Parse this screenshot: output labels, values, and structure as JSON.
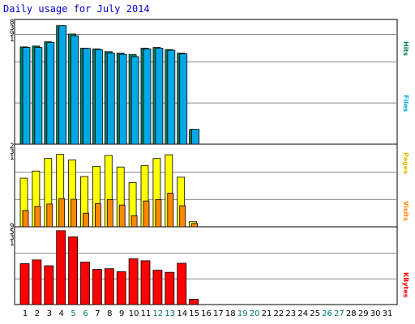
{
  "title": "Daily usage for July 2014",
  "chart_data": [
    {
      "type": "bar",
      "panel": "hits-files",
      "y_max_label": "8391",
      "categories": [
        "1",
        "2",
        "3",
        "4",
        "5",
        "6",
        "7",
        "8",
        "9",
        "10",
        "11",
        "12",
        "13",
        "14",
        "15",
        "16",
        "17",
        "18",
        "19",
        "20",
        "21",
        "22",
        "23",
        "24",
        "25",
        "26",
        "27",
        "28",
        "29",
        "30",
        "31"
      ],
      "weekend_days": [
        "5",
        "6",
        "12",
        "13",
        "19",
        "20",
        "26",
        "27"
      ],
      "series": [
        {
          "name": "Hits",
          "color": "#00805c",
          "values": [
            6890,
            6950,
            7250,
            8391,
            7800,
            6800,
            6750,
            6550,
            6450,
            6350,
            6800,
            6850,
            6700,
            6450,
            1050,
            0,
            0,
            0,
            0,
            0,
            0,
            0,
            0,
            0,
            0,
            0,
            0,
            0,
            0,
            0,
            0
          ]
        },
        {
          "name": "Files",
          "color": "#00a8e8",
          "values": [
            6850,
            6850,
            7200,
            8391,
            7680,
            6780,
            6700,
            6450,
            6350,
            6200,
            6750,
            6800,
            6650,
            6400,
            1050,
            0,
            0,
            0,
            0,
            0,
            0,
            0,
            0,
            0,
            0,
            0,
            0,
            0,
            0,
            0,
            0
          ]
        }
      ],
      "ylim": [
        0,
        8391
      ]
    },
    {
      "type": "bar",
      "panel": "pages-visits",
      "y_max_label": "231",
      "series": [
        {
          "name": "Pages",
          "color": "#ffff00",
          "values": [
            143,
            164,
            201,
            213,
            197,
            148,
            178,
            210,
            176,
            130,
            180,
            201,
            212,
            146,
            15,
            0,
            0,
            0,
            0,
            0,
            0,
            0,
            0,
            0,
            0,
            0,
            0,
            0,
            0,
            0,
            0
          ]
        },
        {
          "name": "Visits",
          "color": "#ff8800",
          "values": [
            48,
            60,
            67,
            83,
            81,
            40,
            68,
            80,
            64,
            33,
            76,
            80,
            99,
            62,
            10,
            0,
            0,
            0,
            0,
            0,
            0,
            0,
            0,
            0,
            0,
            0,
            0,
            0,
            0,
            0,
            0
          ]
        }
      ],
      "ylim": [
        0,
        231
      ],
      "min_label": "9"
    },
    {
      "type": "bar",
      "panel": "kbytes",
      "y_max_label": "531",
      "series": [
        {
          "name": "KBytes",
          "color": "#ff0000",
          "values": [
            294,
            321,
            279,
            531,
            487,
            305,
            253,
            258,
            236,
            329,
            315,
            247,
            232,
            297,
            38,
            0,
            0,
            0,
            0,
            0,
            0,
            0,
            0,
            0,
            0,
            0,
            0,
            0,
            0,
            0,
            0
          ]
        }
      ],
      "ylim": [
        0,
        531
      ]
    }
  ],
  "legend": {
    "hits_label": "Hits",
    "files_label": "Files",
    "pages_label": "Pages",
    "visits_label": "Visits",
    "kbytes_label": "KBytes"
  },
  "colors": {
    "title": "#0000cc",
    "grid": "#888888",
    "frame": "#000000",
    "day_weekday": "#000000",
    "day_weekend": "#007a6b"
  }
}
